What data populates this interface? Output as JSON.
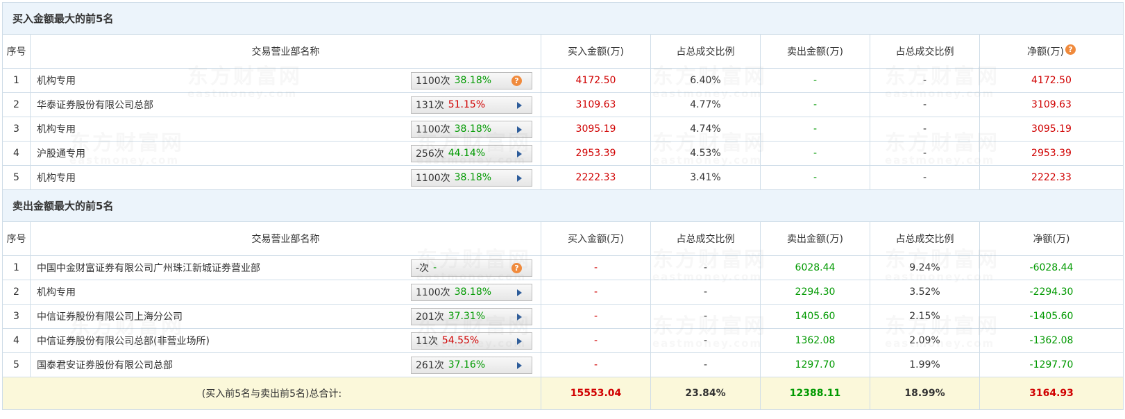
{
  "watermark": {
    "cn": "东方财富网",
    "en": "eastmoney.com"
  },
  "colors": {
    "up": "#d00000",
    "down": "#009900",
    "section_bg": "#ecf4fb",
    "total_bg": "#fbf8da",
    "help_icon": "#f08a3c",
    "arrow": "#2d5c9a"
  },
  "buy_section": {
    "title": "买入金额最大的前5名",
    "headers": {
      "idx": "序号",
      "name": "交易营业部名称",
      "buy": "买入金额(万)",
      "buy_ratio": "占总成交比例",
      "sell": "卖出金额(万)",
      "sell_ratio": "占总成交比例",
      "net": "净额(万)"
    },
    "rows": [
      {
        "idx": "1",
        "name": "机构专用",
        "times": "1100次",
        "rate": "38.18%",
        "buy": "4172.50",
        "buy_ratio": "6.40%",
        "sell": "-",
        "sell_ratio": "-",
        "net": "4172.50"
      },
      {
        "idx": "2",
        "name": "华泰证券股份有限公司总部",
        "times": "131次",
        "rate": "51.15%",
        "buy": "3109.63",
        "buy_ratio": "4.77%",
        "sell": "-",
        "sell_ratio": "-",
        "net": "3109.63"
      },
      {
        "idx": "3",
        "name": "机构专用",
        "times": "1100次",
        "rate": "38.18%",
        "buy": "3095.19",
        "buy_ratio": "4.74%",
        "sell": "-",
        "sell_ratio": "-",
        "net": "3095.19"
      },
      {
        "idx": "4",
        "name": "沪股通专用",
        "times": "256次",
        "rate": "44.14%",
        "buy": "2953.39",
        "buy_ratio": "4.53%",
        "sell": "-",
        "sell_ratio": "-",
        "net": "2953.39"
      },
      {
        "idx": "5",
        "name": "机构专用",
        "times": "1100次",
        "rate": "38.18%",
        "buy": "2222.33",
        "buy_ratio": "3.41%",
        "sell": "-",
        "sell_ratio": "-",
        "net": "2222.33"
      }
    ]
  },
  "sell_section": {
    "title": "卖出金额最大的前5名",
    "headers": {
      "idx": "序号",
      "name": "交易营业部名称",
      "buy": "买入金额(万)",
      "buy_ratio": "占总成交比例",
      "sell": "卖出金额(万)",
      "sell_ratio": "占总成交比例",
      "net": "净额(万)"
    },
    "rows": [
      {
        "idx": "1",
        "name": "中国中金财富证券有限公司广州珠江新城证券营业部",
        "times": "-次",
        "rate": "-",
        "buy": "-",
        "buy_ratio": "-",
        "sell": "6028.44",
        "sell_ratio": "9.24%",
        "net": "-6028.44"
      },
      {
        "idx": "2",
        "name": "机构专用",
        "times": "1100次",
        "rate": "38.18%",
        "buy": "-",
        "buy_ratio": "-",
        "sell": "2294.30",
        "sell_ratio": "3.52%",
        "net": "-2294.30"
      },
      {
        "idx": "3",
        "name": "中信证券股份有限公司上海分公司",
        "times": "201次",
        "rate": "37.31%",
        "buy": "-",
        "buy_ratio": "-",
        "sell": "1405.60",
        "sell_ratio": "2.15%",
        "net": "-1405.60"
      },
      {
        "idx": "4",
        "name": "中信证券股份有限公司总部(非营业场所)",
        "times": "11次",
        "rate": "54.55%",
        "buy": "-",
        "buy_ratio": "-",
        "sell": "1362.08",
        "sell_ratio": "2.09%",
        "net": "-1362.08"
      },
      {
        "idx": "5",
        "name": "国泰君安证券股份有限公司总部",
        "times": "261次",
        "rate": "37.16%",
        "buy": "-",
        "buy_ratio": "-",
        "sell": "1297.70",
        "sell_ratio": "1.99%",
        "net": "-1297.70"
      }
    ]
  },
  "total": {
    "label": "(买入前5名与卖出前5名)总合计:",
    "buy": "15553.04",
    "buy_ratio": "23.84%",
    "sell": "12388.11",
    "sell_ratio": "18.99%",
    "net": "3164.93"
  }
}
